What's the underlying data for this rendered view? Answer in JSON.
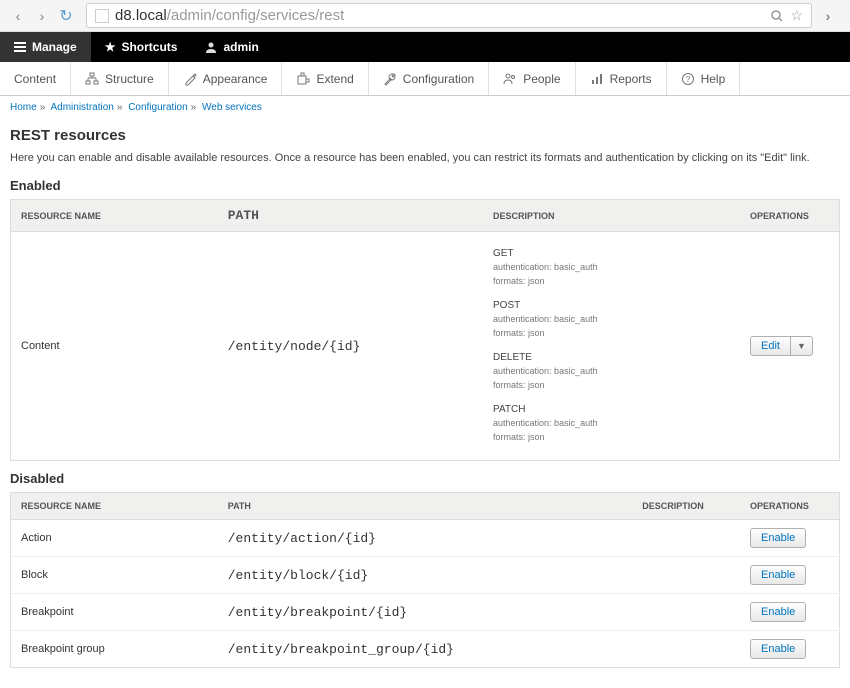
{
  "browser": {
    "url_host": "d8.local",
    "url_path": "/admin/config/services/rest"
  },
  "toolbar": {
    "manage": "Manage",
    "shortcuts": "Shortcuts",
    "user": "admin"
  },
  "tabs": {
    "content": "Content",
    "structure": "Structure",
    "appearance": "Appearance",
    "extend": "Extend",
    "configuration": "Configuration",
    "people": "People",
    "reports": "Reports",
    "help": "Help"
  },
  "breadcrumbs": {
    "b0": "Home",
    "b1": "Administration",
    "b2": "Configuration",
    "b3": "Web services"
  },
  "page": {
    "title": "REST resources",
    "desc": "Here you can enable and disable available resources. Once a resource has been enabled, you can restrict its formats and authentication by clicking on its \"Edit\" link."
  },
  "headings": {
    "enabled": "Enabled",
    "disabled": "Disabled"
  },
  "columns": {
    "name": "RESOURCE NAME",
    "path": "PATH",
    "desc": "DESCRIPTION",
    "ops": "OPERATIONS"
  },
  "enabled_row": {
    "name": "Content",
    "path": "/entity/node/{id}",
    "methods": [
      {
        "name": "GET",
        "auth": "authentication: basic_auth",
        "fmt": "formats: json"
      },
      {
        "name": "POST",
        "auth": "authentication: basic_auth",
        "fmt": "formats: json"
      },
      {
        "name": "DELETE",
        "auth": "authentication: basic_auth",
        "fmt": "formats: json"
      },
      {
        "name": "PATCH",
        "auth": "authentication: basic_auth",
        "fmt": "formats: json"
      }
    ],
    "edit": "Edit"
  },
  "disabled_rows": [
    {
      "name": "Action",
      "path": "/entity/action/{id}"
    },
    {
      "name": "Block",
      "path": "/entity/block/{id}"
    },
    {
      "name": "Breakpoint",
      "path": "/entity/breakpoint/{id}"
    },
    {
      "name": "Breakpoint group",
      "path": "/entity/breakpoint_group/{id}"
    }
  ],
  "buttons": {
    "enable": "Enable"
  }
}
